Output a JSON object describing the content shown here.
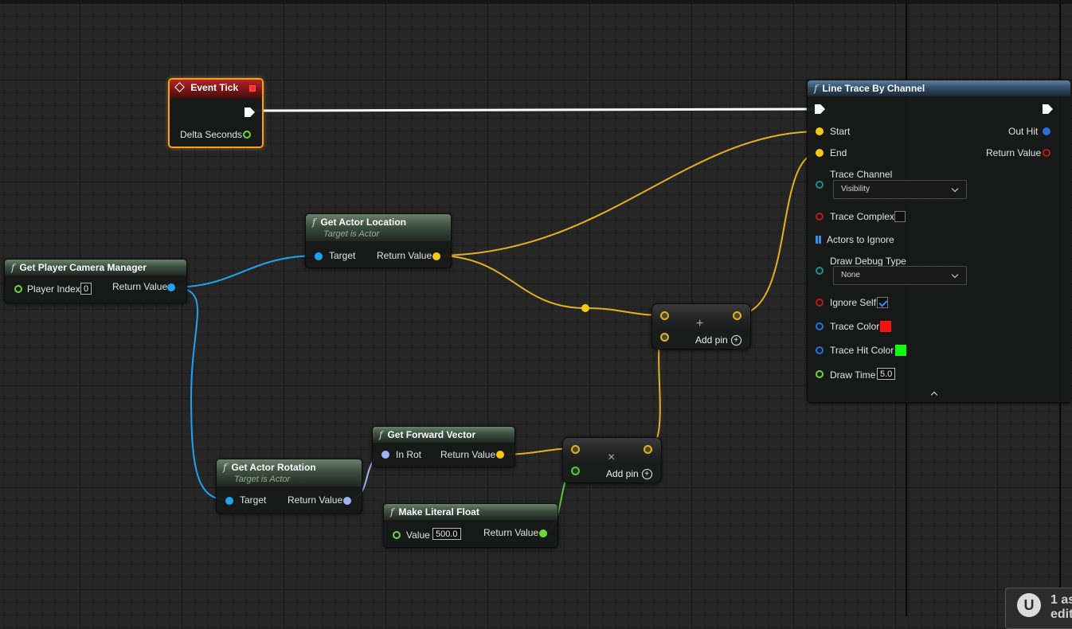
{
  "nodes": {
    "event_tick": {
      "title": "Event Tick",
      "pin_delta": "Delta Seconds"
    },
    "get_player_camera_manager": {
      "title": "Get Player Camera Manager",
      "pin_player_index": "Player Index",
      "player_index_value": "0",
      "pin_return": "Return Value"
    },
    "get_actor_location": {
      "title": "Get Actor Location",
      "subtitle": "Target is Actor",
      "pin_target": "Target",
      "pin_return": "Return Value"
    },
    "get_actor_rotation": {
      "title": "Get Actor Rotation",
      "subtitle": "Target is Actor",
      "pin_target": "Target",
      "pin_return": "Return Value"
    },
    "get_forward_vector": {
      "title": "Get Forward Vector",
      "pin_in_rot": "In Rot",
      "pin_return": "Return Value"
    },
    "make_literal_float": {
      "title": "Make Literal Float",
      "pin_value": "Value",
      "value": "500.0",
      "pin_return": "Return Value"
    },
    "add_node": {
      "symbol": "+",
      "add_pin": "Add pin"
    },
    "multiply_node": {
      "symbol": "×",
      "add_pin": "Add pin"
    },
    "line_trace": {
      "title": "Line Trace By Channel",
      "pin_start": "Start",
      "pin_end": "End",
      "pin_out_hit": "Out Hit",
      "pin_return": "Return Value",
      "trace_channel_label": "Trace Channel",
      "trace_channel_value": "Visibility",
      "trace_complex_label": "Trace Complex",
      "actors_to_ignore_label": "Actors to Ignore",
      "draw_debug_type_label": "Draw Debug Type",
      "draw_debug_type_value": "None",
      "ignore_self_label": "Ignore Self",
      "trace_color_label": "Trace Color",
      "trace_color": "#ff1010",
      "trace_hit_color_label": "Trace Hit Color",
      "trace_hit_color": "#10ff10",
      "draw_time_label": "Draw Time",
      "draw_time_value": "5.0"
    }
  },
  "notification": {
    "text_line1": "1 as",
    "text_line2": "edit"
  },
  "colors": {
    "vector_pin": "#f7c81a",
    "object_pin": "#1fa3f0",
    "rotator_pin": "#9fb4f7",
    "float_pin": "#6cd63c",
    "exec_wire": "#ffffff",
    "selection": "#f2a21c"
  }
}
